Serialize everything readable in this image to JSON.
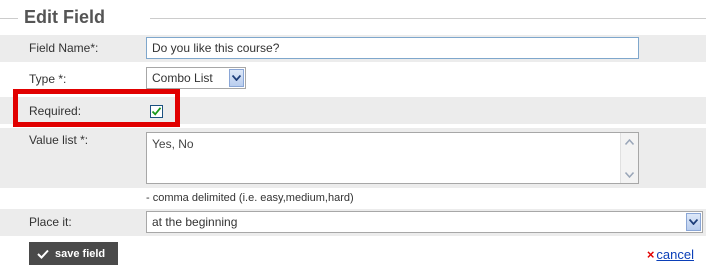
{
  "form": {
    "legend": "Edit Field",
    "field_name": {
      "label": "Field Name*:",
      "value": "Do you like this course?"
    },
    "type": {
      "label": "Type *:",
      "selected": "Combo List"
    },
    "required": {
      "label": "Required:",
      "checked": true
    },
    "value_list": {
      "label": "Value list *:",
      "value": "Yes, No",
      "hint": "- comma delimited (i.e. easy,medium,hard)"
    },
    "place_it": {
      "label": "Place it:",
      "selected": "at the beginning"
    }
  },
  "actions": {
    "save_label": "save field",
    "cancel_label": "cancel",
    "cancel_icon": "×"
  },
  "colors": {
    "highlight": "#e10000",
    "input_border": "#7fa7cc",
    "button_bg": "#4a4a4a",
    "link": "#0b3fb8"
  }
}
